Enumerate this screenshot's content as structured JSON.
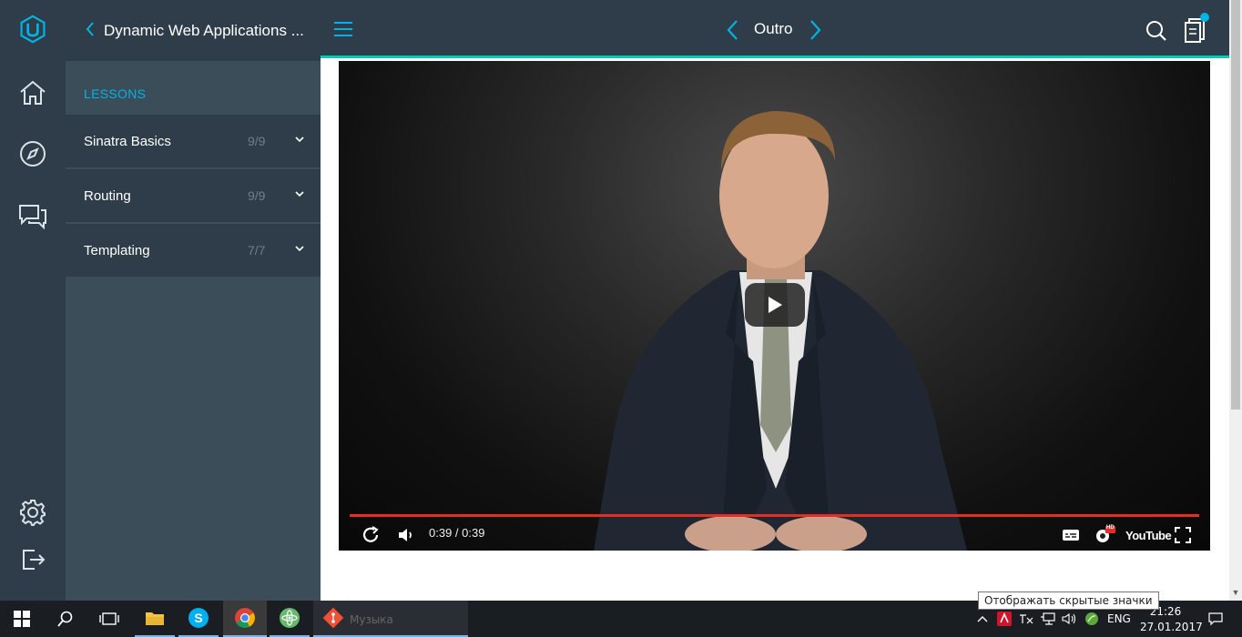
{
  "sidebar": {
    "course_title": "Dynamic Web Applications ...",
    "lessons_label": "LESSONS",
    "lessons": [
      {
        "title": "Sinatra Basics",
        "count": "9/9"
      },
      {
        "title": "Routing",
        "count": "9/9"
      },
      {
        "title": "Templating",
        "count": "7/7"
      }
    ]
  },
  "topbar": {
    "lesson_title": "Outro"
  },
  "video": {
    "time": "0:39 / 0:39",
    "progress": 1.0,
    "youtube_label": "YouTube",
    "hd_badge": "HD"
  },
  "tooltip": "Отображать скрытые значки",
  "taskbar": {
    "ghost_label": "Музыка",
    "language": "ENG",
    "time": "21:26",
    "date": "27.01.2017"
  },
  "colors": {
    "accent": "#02b3e4",
    "teal": "#02ccba",
    "rail": "#2e3d49",
    "sidebar": "#3c4d5a",
    "progress": "#e52d27"
  },
  "icons": {
    "rail": [
      "udacity-logo-icon",
      "home-icon",
      "compass-icon",
      "chat-icon",
      "gear-icon",
      "logout-icon"
    ]
  }
}
